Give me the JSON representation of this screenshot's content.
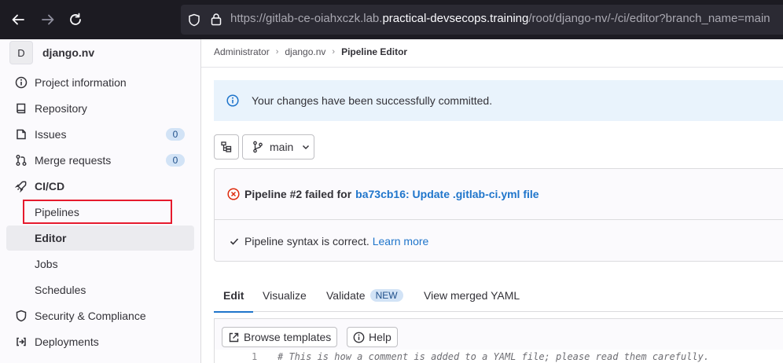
{
  "browser": {
    "url_prefix": "https://gitlab-ce-oiahxczk.lab.",
    "url_host": "practical-devsecops.training",
    "url_path": "/root/django-nv/-/ci/editor?branch_name=main"
  },
  "sidebar": {
    "project_initial": "D",
    "project_name": "django.nv",
    "items": [
      {
        "label": "Project information",
        "icon": "info-icon"
      },
      {
        "label": "Repository",
        "icon": "book-icon"
      },
      {
        "label": "Issues",
        "icon": "issues-icon",
        "badge": "0"
      },
      {
        "label": "Merge requests",
        "icon": "merge-request-icon",
        "badge": "0"
      },
      {
        "label": "CI/CD",
        "icon": "rocket-icon"
      }
    ],
    "cicd_sub": [
      {
        "label": "Pipelines"
      },
      {
        "label": "Editor"
      },
      {
        "label": "Jobs"
      },
      {
        "label": "Schedules"
      }
    ],
    "bottom_items": [
      {
        "label": "Security & Compliance",
        "icon": "shield-icon"
      },
      {
        "label": "Deployments",
        "icon": "deployments-icon"
      }
    ]
  },
  "breadcrumb": [
    "Administrator",
    "django.nv",
    "Pipeline Editor"
  ],
  "alert": {
    "text": "Your changes have been successfully committed."
  },
  "branch": {
    "label": "main"
  },
  "pipeline": {
    "status_text": "Pipeline #2 failed for",
    "commit_link": "ba73cb16: Update .gitlab-ci.yml file",
    "syntax_text": "Pipeline syntax is correct.",
    "learn_more": "Learn more"
  },
  "tabs": {
    "edit": "Edit",
    "visualize": "Visualize",
    "validate": "Validate",
    "validate_badge": "NEW",
    "view_merged": "View merged YAML"
  },
  "editor": {
    "browse_templates": "Browse templates",
    "help": "Help",
    "line_number": "1",
    "first_line": "# This is how a comment is added to a YAML file; please read them carefully."
  },
  "colors": {
    "accent_blue": "#1f75cb",
    "danger_red": "#dd2b0e",
    "highlight_red": "#e61a2d"
  }
}
